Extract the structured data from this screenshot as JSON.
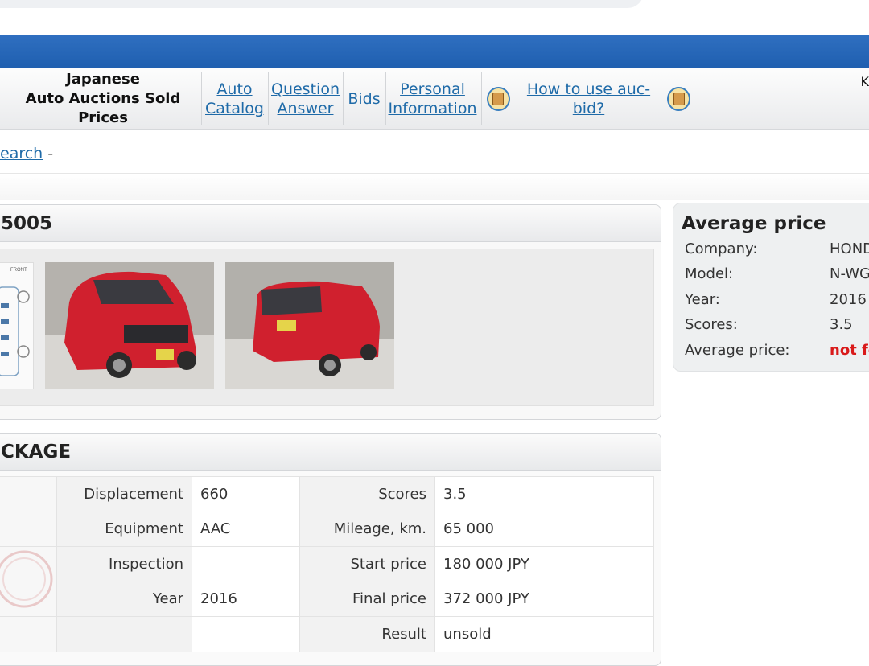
{
  "menu": {
    "title_line1": "Japanese",
    "title_line2": "Auto Auctions Sold Prices",
    "auto_catalog_1": "Auto",
    "auto_catalog_2": "Catalog",
    "question_1": "Question",
    "question_2": "Answer",
    "bids": "Bids",
    "personal_1": "Personal",
    "personal_2": "Information",
    "how_to": "How to use auc-bid?",
    "k_fragment": "K"
  },
  "breadcrumb": {
    "link": "earch",
    "sep": "-"
  },
  "lot": {
    "title": "5005"
  },
  "package": {
    "title": "CKAGE"
  },
  "average": {
    "title": "Average price",
    "labels": [
      "Company:",
      "Model:",
      "Year:",
      "Scores:",
      "Average price:"
    ],
    "values": [
      "HOND",
      "N-WG",
      "2016",
      "3.5",
      "not fo"
    ]
  },
  "specs": {
    "rows": [
      {
        "l1": "Displacement",
        "v1": "660",
        "l2": "Scores",
        "v2": "3.5"
      },
      {
        "l1": "Equipment",
        "v1": "AAC",
        "l2": "Mileage, km.",
        "v2": "65 000"
      },
      {
        "l1": "Inspection",
        "v1": "",
        "l2": "Start price",
        "v2": "180 000 JPY"
      },
      {
        "l1": "Year",
        "v1": "2016",
        "l2": "Final price",
        "v2": "372 000 JPY"
      },
      {
        "l1": "",
        "v1": "",
        "l2": "Result",
        "v2": "unsold"
      }
    ]
  },
  "colors": {
    "header_blue": "#1f5fb0",
    "link": "#1e6aa8",
    "alert_red": "#d91a1a",
    "car_red": "#d0202e"
  }
}
